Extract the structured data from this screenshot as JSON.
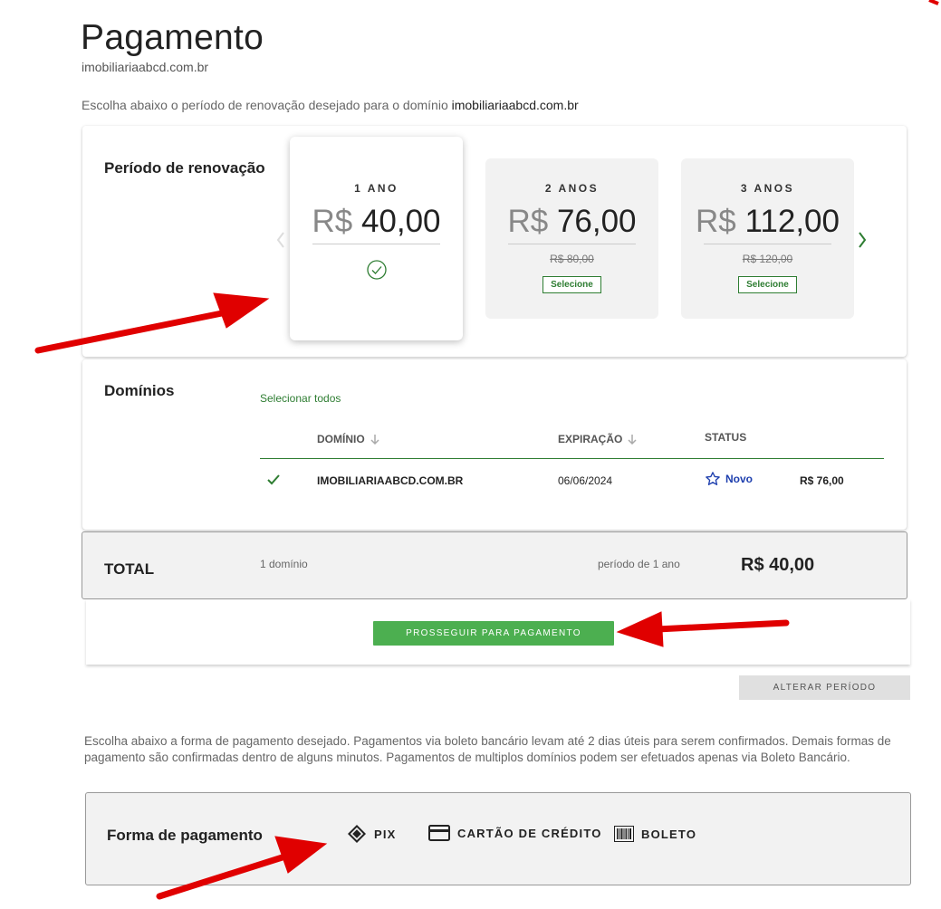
{
  "page": {
    "title": "Pagamento",
    "subtitle": "imobiliariaabcd.com.br",
    "intro_text": "Escolha abaixo o período de renovação desejado para o domínio ",
    "intro_domain": "imobiliariaabcd.com.br"
  },
  "renewal": {
    "label": "Período de renovação",
    "plans": [
      {
        "years": "1 ANO",
        "currency": "R$",
        "price": "40,00",
        "selected": true
      },
      {
        "years": "2 ANOS",
        "currency": "R$",
        "price": "76,00",
        "old_price": "R$ 80,00",
        "select_label": "Selecione"
      },
      {
        "years": "3 ANOS",
        "currency": "R$",
        "price": "112,00",
        "old_price": "R$ 120,00",
        "select_label": "Selecione"
      }
    ]
  },
  "domains": {
    "label": "Domínios",
    "select_all": "Selecionar todos",
    "columns": {
      "domain": "DOMÍNIO",
      "expiration": "EXPIRAÇÃO",
      "status": "STATUS"
    },
    "rows": [
      {
        "domain": "IMOBILIARIAABCD.COM.BR",
        "expiration": "06/06/2024",
        "status": "Novo",
        "price": "R$ 76,00"
      }
    ]
  },
  "total": {
    "label": "TOTAL",
    "count": "1 domínio",
    "period": "período de 1 ano",
    "amount": "R$ 40,00"
  },
  "actions": {
    "proceed": "PROSSEGUIR PARA PAGAMENTO",
    "change_period": "ALTERAR PERÍODO"
  },
  "payment": {
    "description": "Escolha abaixo a forma de pagamento desejado. Pagamentos via boleto bancário levam até 2 dias úteis para serem confirmados. Demais formas de pagamento são confirmadas dentro de alguns minutos. Pagamentos de multiplos domínios podem ser efetuados apenas via Boleto Bancário.",
    "label": "Forma de pagamento",
    "options": [
      {
        "label": "PIX",
        "icon": "pix-icon"
      },
      {
        "label": "CARTÃO DE CRÉDITO",
        "icon": "credit-card-icon"
      },
      {
        "label": "BOLETO",
        "icon": "barcode-icon"
      }
    ]
  },
  "colors": {
    "accent_green": "#4caf50",
    "dark_green": "#2e7d32",
    "status_blue": "#1e3fae",
    "annotation_red": "#e00000"
  }
}
